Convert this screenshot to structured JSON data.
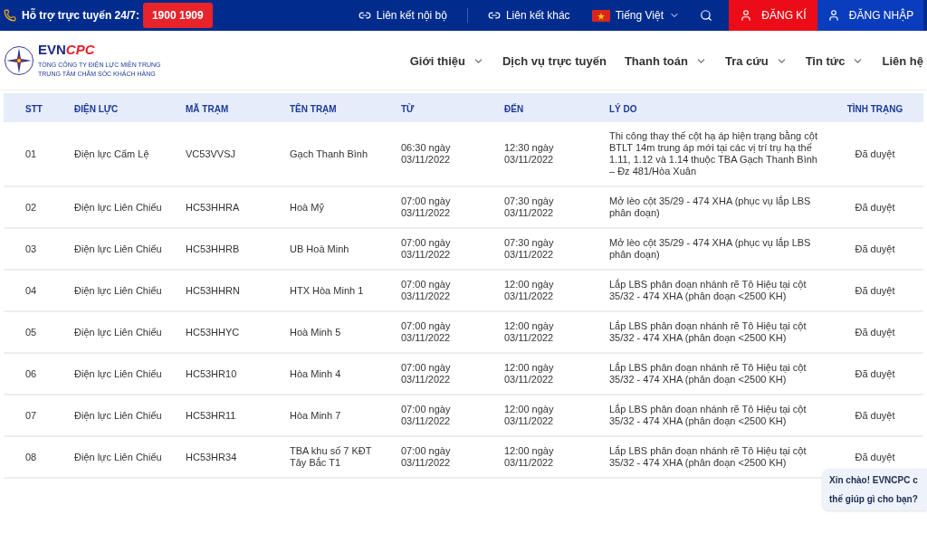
{
  "top_bar": {
    "support_label": "Hỗ trợ trực tuyến 24/7:",
    "hotline": "1900 1909",
    "links": [
      "Liên kết nội bộ",
      "Liên kết khác"
    ],
    "language": "Tiếng Việt",
    "register": "ĐĂNG KÍ",
    "login": "ĐĂNG NHẬP"
  },
  "logo": {
    "brand_a": "EVN",
    "brand_b": "CPC",
    "line_1": "TỔNG CÔNG TY ĐIỆN LỰC MIỀN TRUNG",
    "line_2": "TRUNG TÂM CHĂM SÓC KHÁCH HÀNG"
  },
  "nav": [
    {
      "label": "Giới thiệu",
      "dropdown": true
    },
    {
      "label": "Dịch vụ trực tuyến",
      "dropdown": false
    },
    {
      "label": "Thanh toán",
      "dropdown": true
    },
    {
      "label": "Tra cứu",
      "dropdown": true
    },
    {
      "label": "Tin tức",
      "dropdown": true
    },
    {
      "label": "Liên hệ",
      "dropdown": false
    }
  ],
  "table": {
    "columns": [
      "STT",
      "ĐIỆN LỰC",
      "MÃ TRẠM",
      "TÊN TRẠM",
      "TỪ",
      "ĐẾN",
      "LÝ DO",
      "TÌNH TRẠNG"
    ],
    "rows": [
      [
        "01",
        "Điện lực Cẩm Lệ",
        "VC53VVSJ",
        "Gạch Thanh Bình",
        "06:30 ngày 03/11/2022",
        "12:30 ngày 03/11/2022",
        "Thi công thay thế cột hạ áp hiện trạng bằng cột BTLT 14m trung áp mới tại các vị trí trụ hạ thế 1.11, 1.12 và 1.14 thuộc TBA Gạch Thanh Bình – Đz 481/Hòa Xuân",
        "Đã duyệt"
      ],
      [
        "02",
        "Điện lực Liên Chiểu",
        "HC53HHRA",
        "Hoà Mỹ",
        "07:00 ngày 03/11/2022",
        "07:30 ngày 03/11/2022",
        "Mở lèo cột 35/29 - 474 XHA (phục vụ lắp LBS phân đoạn)",
        "Đã duyệt"
      ],
      [
        "03",
        "Điện lực Liên Chiểu",
        "HC53HHRB",
        "UB Hoà Minh",
        "07:00 ngày 03/11/2022",
        "07:30 ngày 03/11/2022",
        "Mở lèo cột 35/29 - 474 XHA (phục vụ lắp LBS phân đoạn)",
        "Đã duyệt"
      ],
      [
        "04",
        "Điện lực Liên Chiểu",
        "HC53HHRN",
        "HTX Hòa Minh 1",
        "07:00 ngày 03/11/2022",
        "12:00 ngày 03/11/2022",
        "Lắp LBS phân đoạn nhánh rẽ Tô Hiệu tại cột 35/32 - 474 XHA (phân đoạn <2500 KH)",
        "Đã duyệt"
      ],
      [
        "05",
        "Điện lực Liên Chiểu",
        "HC53HHYC",
        "Hoà Minh 5",
        "07:00 ngày 03/11/2022",
        "12:00 ngày 03/11/2022",
        "Lắp LBS phân đoạn nhánh rẽ Tô Hiệu tại cột 35/32 - 474 XHA (phân đoạn <2500 KH)",
        "Đã duyệt"
      ],
      [
        "06",
        "Điện lực Liên Chiểu",
        "HC53HR10",
        "Hòa Minh 4",
        "07:00 ngày 03/11/2022",
        "12:00 ngày 03/11/2022",
        "Lắp LBS phân đoạn nhánh rẽ Tô Hiệu tại cột 35/32 - 474 XHA (phân đoạn <2500 KH)",
        "Đã duyệt"
      ],
      [
        "07",
        "Điện lực Liên Chiểu",
        "HC53HR11",
        "Hòa Minh 7",
        "07:00 ngày 03/11/2022",
        "12:00 ngày 03/11/2022",
        "Lắp LBS phân đoạn nhánh rẽ Tô Hiệu tại cột 35/32 - 474 XHA (phân đoạn <2500 KH)",
        "Đã duyệt"
      ],
      [
        "08",
        "Điện lực Liên Chiểu",
        "HC53HR34",
        "TBA khu số 7 KĐT Tây Bắc T1",
        "07:00 ngày 03/11/2022",
        "12:00 ngày 03/11/2022",
        "Lắp LBS phân đoạn nhánh rẽ Tô Hiệu tại cột 35/32 - 474 XHA (phân đoạn <2500 KH)",
        "Đã duyệt"
      ]
    ]
  },
  "chat_bubble": [
    "Xin chào! EVNCPC c",
    "thế giúp gì cho bạn?"
  ]
}
